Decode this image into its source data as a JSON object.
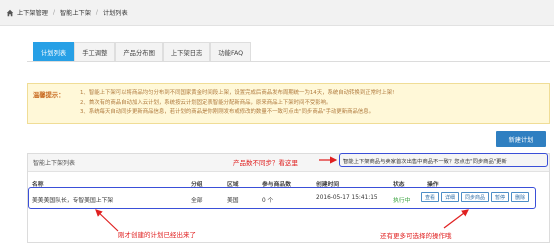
{
  "breadcrumb": {
    "items": [
      "上下架管理",
      "智能上下架",
      "计划列表"
    ]
  },
  "tabs": [
    {
      "label": "计划列表",
      "active": true
    },
    {
      "label": "手工调整",
      "active": false
    },
    {
      "label": "产品分布图",
      "active": false
    },
    {
      "label": "上下架日志",
      "active": false
    },
    {
      "label": "功能FAQ",
      "active": false
    }
  ],
  "notice": {
    "label": "温馨提示：",
    "lines": [
      "1、智能上下架可以将商品均匀分布到不同国家黄金时间段上架，设置完成后商品发布周期统一为14天，系统自动转换到正常时上架!",
      "2、首次有的商品自动加入云计划，系统按云计划固定表智能分配新商品，原来商品上下架时间不受影响。",
      "3、系统每天自动同步更新商品信息，若计划的商品是你刚刚发布或修改的数量不一致可点击\"同步商品\"手动更新商品信息。"
    ]
  },
  "new_plan_button": "新建计划",
  "panel": {
    "title": "智能上下架列表"
  },
  "annotations": {
    "sync_question": "产品数不同步？看这里",
    "sync_tip": "智能上下架商品与卖家首次出售中商品不一致？您点击\"同步商品\"更新",
    "just_created": "刚才创建的计划已经出来了",
    "more_ops": "还有更多可选择的操作哦"
  },
  "table": {
    "headers": {
      "name": "名称",
      "category": "分组",
      "region": "区域",
      "count": "参与商品数",
      "created": "创建时间",
      "status": "状态",
      "ops": "操作"
    },
    "rows": [
      {
        "name": "美美美国队长，专智美国上下架",
        "category": "全部",
        "region": "美国",
        "count": "0 个",
        "created": "2016-05-17 15:41:15",
        "status": "执行中",
        "ops": [
          "查看",
          "详细",
          "同步商品",
          "暂停",
          "删除"
        ]
      }
    ]
  },
  "colors": {
    "active_tab": "#27a0e6",
    "button": "#2f7fc1",
    "annotation_red": "#e02020",
    "annotation_box": "#3a4fd8",
    "status_green": "#35a03a"
  }
}
